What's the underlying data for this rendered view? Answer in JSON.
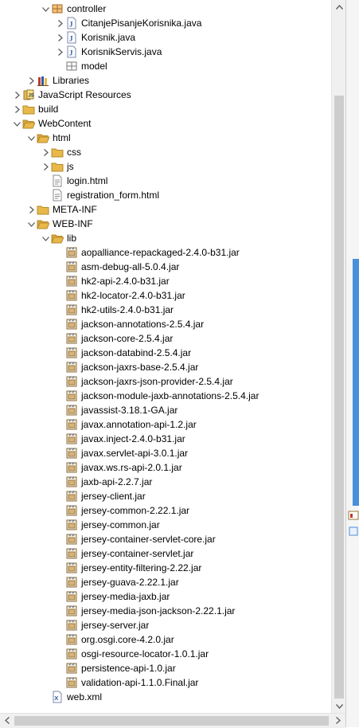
{
  "tree": {
    "items": [
      {
        "label": "controller",
        "depth": 4,
        "toggle": "expanded",
        "icon": "package-icon"
      },
      {
        "label": "CitanjePisanjeKorisnika.java",
        "depth": 5,
        "toggle": "collapsed",
        "icon": "java-file-icon"
      },
      {
        "label": "Korisnik.java",
        "depth": 5,
        "toggle": "collapsed",
        "icon": "java-file-icon"
      },
      {
        "label": "KorisnikServis.java",
        "depth": 5,
        "toggle": "collapsed",
        "icon": "java-file-icon"
      },
      {
        "label": "model",
        "depth": 5,
        "toggle": "none",
        "icon": "empty-package-icon"
      },
      {
        "label": "Libraries",
        "depth": 3,
        "toggle": "collapsed",
        "icon": "library-icon"
      },
      {
        "label": "JavaScript Resources",
        "depth": 2,
        "toggle": "collapsed",
        "icon": "js-resources-icon"
      },
      {
        "label": "build",
        "depth": 2,
        "toggle": "collapsed",
        "icon": "folder-icon"
      },
      {
        "label": "WebContent",
        "depth": 2,
        "toggle": "expanded",
        "icon": "folder-open-icon"
      },
      {
        "label": "html",
        "depth": 3,
        "toggle": "expanded",
        "icon": "folder-open-icon"
      },
      {
        "label": "css",
        "depth": 4,
        "toggle": "collapsed",
        "icon": "folder-icon"
      },
      {
        "label": "js",
        "depth": 4,
        "toggle": "collapsed",
        "icon": "folder-icon"
      },
      {
        "label": "login.html",
        "depth": 4,
        "toggle": "none",
        "icon": "html-file-icon"
      },
      {
        "label": "registration_form.html",
        "depth": 4,
        "toggle": "none",
        "icon": "html-file-icon"
      },
      {
        "label": "META-INF",
        "depth": 3,
        "toggle": "collapsed",
        "icon": "folder-icon"
      },
      {
        "label": "WEB-INF",
        "depth": 3,
        "toggle": "expanded",
        "icon": "folder-open-icon"
      },
      {
        "label": "lib",
        "depth": 4,
        "toggle": "expanded",
        "icon": "folder-open-icon"
      },
      {
        "label": "aopalliance-repackaged-2.4.0-b31.jar",
        "depth": 5,
        "toggle": "none",
        "icon": "jar-icon"
      },
      {
        "label": "asm-debug-all-5.0.4.jar",
        "depth": 5,
        "toggle": "none",
        "icon": "jar-icon"
      },
      {
        "label": "hk2-api-2.4.0-b31.jar",
        "depth": 5,
        "toggle": "none",
        "icon": "jar-icon"
      },
      {
        "label": "hk2-locator-2.4.0-b31.jar",
        "depth": 5,
        "toggle": "none",
        "icon": "jar-icon"
      },
      {
        "label": "hk2-utils-2.4.0-b31.jar",
        "depth": 5,
        "toggle": "none",
        "icon": "jar-icon"
      },
      {
        "label": "jackson-annotations-2.5.4.jar",
        "depth": 5,
        "toggle": "none",
        "icon": "jar-icon"
      },
      {
        "label": "jackson-core-2.5.4.jar",
        "depth": 5,
        "toggle": "none",
        "icon": "jar-icon"
      },
      {
        "label": "jackson-databind-2.5.4.jar",
        "depth": 5,
        "toggle": "none",
        "icon": "jar-icon"
      },
      {
        "label": "jackson-jaxrs-base-2.5.4.jar",
        "depth": 5,
        "toggle": "none",
        "icon": "jar-icon"
      },
      {
        "label": "jackson-jaxrs-json-provider-2.5.4.jar",
        "depth": 5,
        "toggle": "none",
        "icon": "jar-icon"
      },
      {
        "label": "jackson-module-jaxb-annotations-2.5.4.jar",
        "depth": 5,
        "toggle": "none",
        "icon": "jar-icon"
      },
      {
        "label": "javassist-3.18.1-GA.jar",
        "depth": 5,
        "toggle": "none",
        "icon": "jar-icon"
      },
      {
        "label": "javax.annotation-api-1.2.jar",
        "depth": 5,
        "toggle": "none",
        "icon": "jar-icon"
      },
      {
        "label": "javax.inject-2.4.0-b31.jar",
        "depth": 5,
        "toggle": "none",
        "icon": "jar-icon"
      },
      {
        "label": "javax.servlet-api-3.0.1.jar",
        "depth": 5,
        "toggle": "none",
        "icon": "jar-icon"
      },
      {
        "label": "javax.ws.rs-api-2.0.1.jar",
        "depth": 5,
        "toggle": "none",
        "icon": "jar-icon"
      },
      {
        "label": "jaxb-api-2.2.7.jar",
        "depth": 5,
        "toggle": "none",
        "icon": "jar-icon"
      },
      {
        "label": "jersey-client.jar",
        "depth": 5,
        "toggle": "none",
        "icon": "jar-icon"
      },
      {
        "label": "jersey-common-2.22.1.jar",
        "depth": 5,
        "toggle": "none",
        "icon": "jar-icon"
      },
      {
        "label": "jersey-common.jar",
        "depth": 5,
        "toggle": "none",
        "icon": "jar-icon"
      },
      {
        "label": "jersey-container-servlet-core.jar",
        "depth": 5,
        "toggle": "none",
        "icon": "jar-icon"
      },
      {
        "label": "jersey-container-servlet.jar",
        "depth": 5,
        "toggle": "none",
        "icon": "jar-icon"
      },
      {
        "label": "jersey-entity-filtering-2.22.jar",
        "depth": 5,
        "toggle": "none",
        "icon": "jar-icon"
      },
      {
        "label": "jersey-guava-2.22.1.jar",
        "depth": 5,
        "toggle": "none",
        "icon": "jar-icon"
      },
      {
        "label": "jersey-media-jaxb.jar",
        "depth": 5,
        "toggle": "none",
        "icon": "jar-icon"
      },
      {
        "label": "jersey-media-json-jackson-2.22.1.jar",
        "depth": 5,
        "toggle": "none",
        "icon": "jar-icon"
      },
      {
        "label": "jersey-server.jar",
        "depth": 5,
        "toggle": "none",
        "icon": "jar-icon"
      },
      {
        "label": "org.osgi.core-4.2.0.jar",
        "depth": 5,
        "toggle": "none",
        "icon": "jar-icon"
      },
      {
        "label": "osgi-resource-locator-1.0.1.jar",
        "depth": 5,
        "toggle": "none",
        "icon": "jar-icon"
      },
      {
        "label": "persistence-api-1.0.jar",
        "depth": 5,
        "toggle": "none",
        "icon": "jar-icon"
      },
      {
        "label": "validation-api-1.1.0.Final.jar",
        "depth": 5,
        "toggle": "none",
        "icon": "jar-icon"
      },
      {
        "label": "web.xml",
        "depth": 4,
        "toggle": "none",
        "icon": "xml-file-icon"
      }
    ]
  },
  "colors": {
    "folder": "#e8b84a",
    "package": "#a56b2b",
    "java": "#2c5aa0",
    "jar": "#8a6a3a",
    "accent": "#4a90d9"
  }
}
